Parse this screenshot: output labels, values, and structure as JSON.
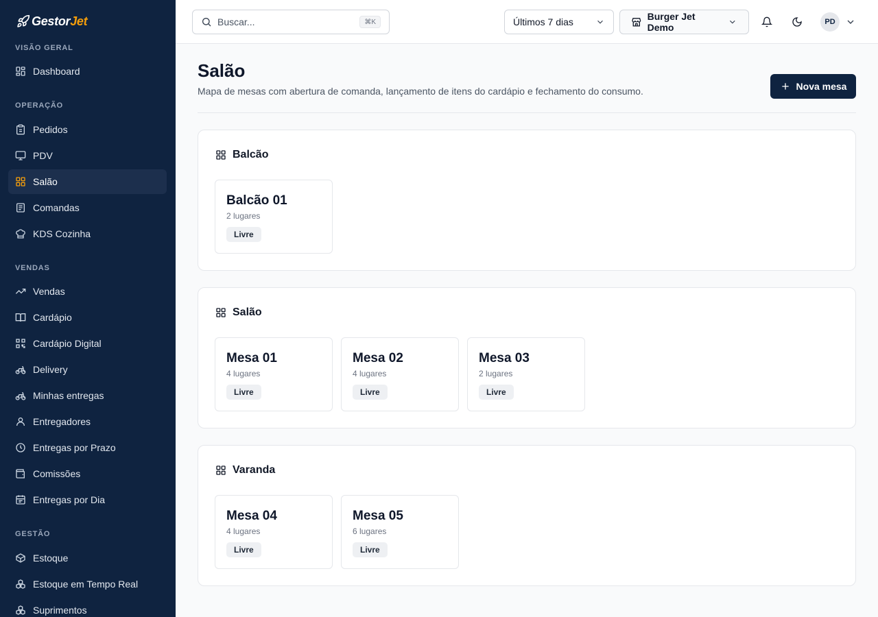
{
  "brand": {
    "name_main": "Gestor",
    "name_accent": "Jet"
  },
  "sidebar": {
    "sections": [
      {
        "label": "VISÃO GERAL",
        "items": [
          {
            "label": "Dashboard",
            "icon": "grid-icon"
          }
        ]
      },
      {
        "label": "OPERAÇÃO",
        "items": [
          {
            "label": "Pedidos",
            "icon": "clipboard-icon"
          },
          {
            "label": "PDV",
            "icon": "monitor-icon"
          },
          {
            "label": "Salão",
            "icon": "grid-icon",
            "active": true
          },
          {
            "label": "Comandas",
            "icon": "receipt-icon"
          },
          {
            "label": "KDS Cozinha",
            "icon": "chef-hat-icon"
          }
        ]
      },
      {
        "label": "VENDAS",
        "items": [
          {
            "label": "Vendas",
            "icon": "trending-up-icon"
          },
          {
            "label": "Cardápio",
            "icon": "book-icon"
          },
          {
            "label": "Cardápio Digital",
            "icon": "qr-code-icon"
          },
          {
            "label": "Delivery",
            "icon": "bike-icon"
          },
          {
            "label": "Minhas entregas",
            "icon": "bike-icon"
          },
          {
            "label": "Entregadores",
            "icon": "user-icon"
          },
          {
            "label": "Entregas por Prazo",
            "icon": "clock-icon"
          },
          {
            "label": "Comissões",
            "icon": "wallet-icon"
          },
          {
            "label": "Entregas por Dia",
            "icon": "calendar-icon"
          }
        ]
      },
      {
        "label": "GESTÃO",
        "items": [
          {
            "label": "Estoque",
            "icon": "box-icon"
          },
          {
            "label": "Estoque em Tempo Real",
            "icon": "boxes-icon"
          },
          {
            "label": "Suprimentos",
            "icon": "boxes-icon"
          }
        ]
      }
    ]
  },
  "topbar": {
    "search_placeholder": "Buscar...",
    "search_shortcut": "⌘K",
    "period": "Últimos 7 dias",
    "store": "Burger Jet Demo",
    "avatar_initials": "PD"
  },
  "page": {
    "title": "Salão",
    "subtitle": "Mapa de mesas com abertura de comanda, lançamento de itens do cardápio e fechamento do consumo.",
    "new_button": "Nova mesa"
  },
  "areas": [
    {
      "name": "Balcão",
      "tables": [
        {
          "name": "Balcão 01",
          "seats": "2 lugares",
          "status": "Livre"
        }
      ]
    },
    {
      "name": "Salão",
      "tables": [
        {
          "name": "Mesa 01",
          "seats": "4 lugares",
          "status": "Livre"
        },
        {
          "name": "Mesa 02",
          "seats": "4 lugares",
          "status": "Livre"
        },
        {
          "name": "Mesa 03",
          "seats": "2 lugares",
          "status": "Livre"
        }
      ]
    },
    {
      "name": "Varanda",
      "tables": [
        {
          "name": "Mesa 04",
          "seats": "4 lugares",
          "status": "Livre"
        },
        {
          "name": "Mesa 05",
          "seats": "6 lugares",
          "status": "Livre"
        }
      ]
    }
  ],
  "colors": {
    "sidebar_bg": "#0f2340",
    "accent": "#f59e0b",
    "primary_button": "#0f2340"
  }
}
